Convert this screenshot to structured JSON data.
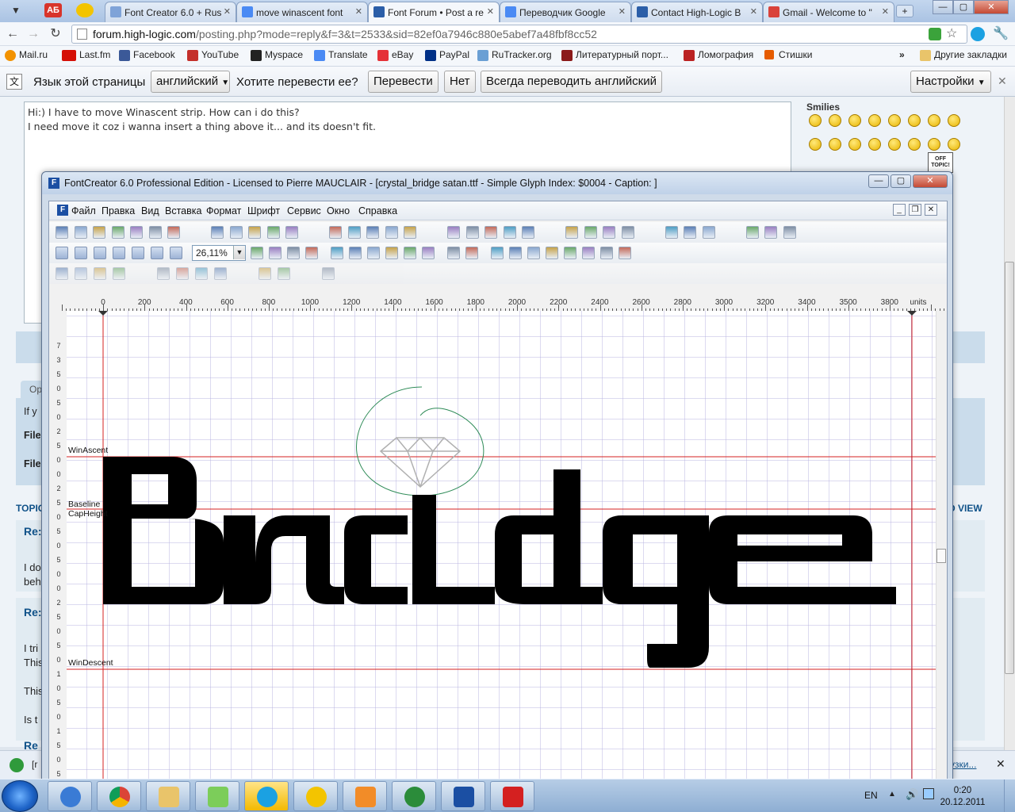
{
  "browser": {
    "tabs": [
      {
        "title": "Font Creator 6.0 + Rus",
        "active": false
      },
      {
        "title": "move winascent font",
        "active": false
      },
      {
        "title": "Font Forum • Post a re",
        "active": true
      },
      {
        "title": "Переводчик Google",
        "active": false
      },
      {
        "title": "Contact High-Logic B",
        "active": false
      },
      {
        "title": "Gmail - Welcome to \"",
        "active": false
      }
    ],
    "url_host": "forum.high-logic.com",
    "url_path": "/posting.php?mode=reply&f=3&t=2533&sid=82ef0a7946c880e5abef7a48fbf8cc52",
    "bookmarks": [
      "Mail.ru",
      "Last.fm",
      "Facebook",
      "YouTube",
      "Myspace",
      "Translate",
      "eBay",
      "PayPal",
      "RuTracker.org",
      "Литературный порт...",
      "Ломография",
      "Стишки"
    ],
    "bookmarks_overflow": "»",
    "other_bookmarks": "Другие закладки"
  },
  "translate_bar": {
    "prompt": "Язык этой страницы",
    "language": "английский",
    "question": "Хотите перевести ее?",
    "translate_button": "Перевести",
    "no_button": "Нет",
    "always_button": "Всегда переводить английский",
    "settings_button": "Настройки"
  },
  "forum": {
    "post_line1": "Hi:) I have to move Winascent strip. How can i do this?",
    "post_line2": "I need move it coz i wanna insert a thing above it... and its doesn't fit.",
    "smilies_title": "Smilies",
    "sticker": "OFF TOPIC!",
    "tab_label": "Op",
    "box_line1": "If y",
    "box_line2": "File",
    "box_line3": "File",
    "topic_label": "TOPIC",
    "view_label": "D VIEW",
    "posts": [
      "Re:",
      "I do",
      "beh",
      "Re:",
      "I tri",
      "This",
      "This",
      "Is t",
      "Re"
    ],
    "status_text": "[r",
    "status_right": "узки..."
  },
  "fontcreator": {
    "title": "FontCreator 6.0 Professional Edition - Licensed to Pierre MAUCLAIR - [crystal_bridge satan.ttf - Simple Glyph Index: $0004 - Caption: ]",
    "menu": [
      "Файл",
      "Правка",
      "Вид",
      "Вставка",
      "Формат",
      "Шрифт",
      "Сервис",
      "Окно",
      "Справка"
    ],
    "zoom": "26,11%",
    "ruler_ticks": [
      "0",
      "200",
      "400",
      "600",
      "800",
      "1000",
      "1200",
      "1400",
      "1600",
      "1800",
      "2000",
      "2200",
      "2400",
      "2600",
      "2800",
      "3000",
      "3200",
      "3400",
      "3500",
      "3800"
    ],
    "ruler_unit": "units",
    "left_ruler": [
      "7",
      "3",
      "5",
      "0",
      "5",
      "0",
      "2",
      "5",
      "0",
      "0",
      "2",
      "5",
      "0",
      "5",
      "0",
      "5",
      "0",
      "0",
      "2",
      "5",
      "0",
      "5",
      "0",
      "1",
      "0",
      "5",
      "0",
      "1",
      "5",
      "0",
      "5",
      "0"
    ],
    "metrics": {
      "win_ascent": "WinAscent",
      "baseline": "Baseline",
      "cap_height": "CapHeight",
      "win_descent": "WinDescent"
    },
    "glyph_text": "Bridge"
  },
  "taskbar": {
    "lang": "EN",
    "time": "0:20",
    "date": "20.12.2011"
  }
}
